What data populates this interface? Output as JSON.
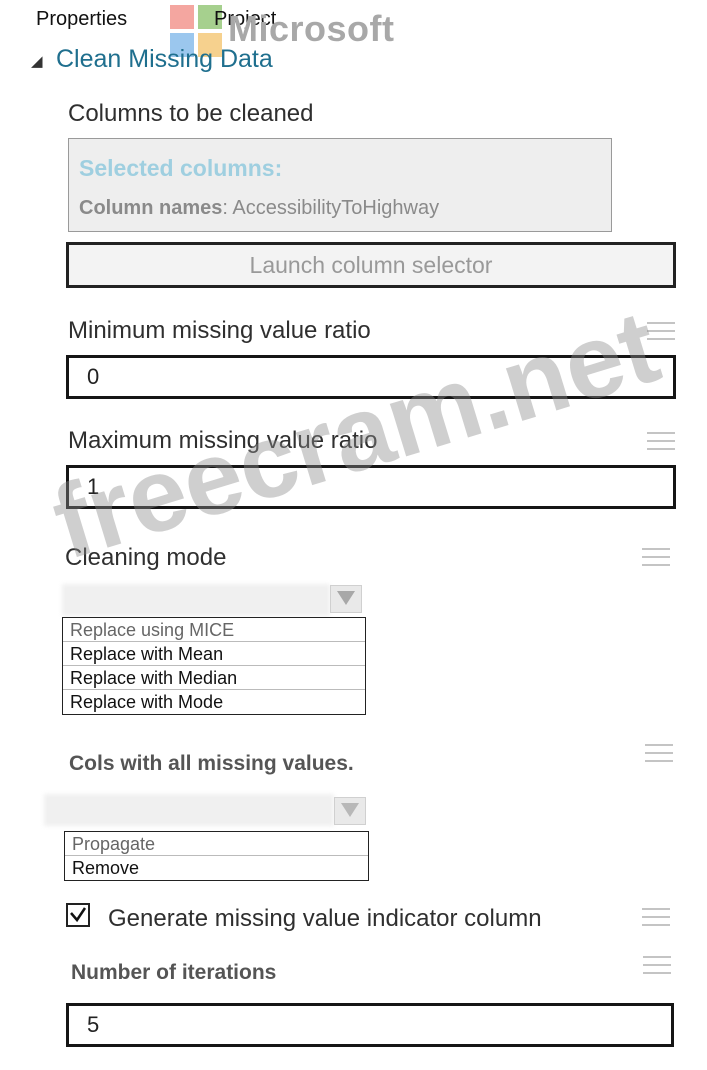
{
  "header": {
    "tabs": [
      "Properties",
      "Project"
    ],
    "logo_text": "Microsoft",
    "logo_colors": [
      "#f25022",
      "#7fba00",
      "#00a4ef",
      "#ffb900"
    ]
  },
  "module": {
    "title": "Clean Missing Data",
    "columns": {
      "label": "Columns to be cleaned",
      "selected_heading": "Selected columns:",
      "names_label": "Column names",
      "names_value": ": AccessibilityToHighway",
      "launch_button": "Launch column selector"
    },
    "min_ratio": {
      "label": "Minimum missing value ratio",
      "value": "0"
    },
    "max_ratio": {
      "label": "Maximum missing value ratio",
      "value": "1"
    },
    "cleaning_mode": {
      "label": "Cleaning mode",
      "options": [
        "Replace using MICE",
        "Replace with Mean",
        "Replace with Median",
        "Replace with Mode"
      ]
    },
    "cols_all_missing": {
      "label": "Cols with all missing values.",
      "options": [
        "Propagate",
        "Remove"
      ]
    },
    "indicator": {
      "label": "Generate missing value indicator column",
      "checked": true
    },
    "iterations": {
      "label": "Number of iterations",
      "value": "5"
    }
  },
  "watermark": "freecram.net"
}
